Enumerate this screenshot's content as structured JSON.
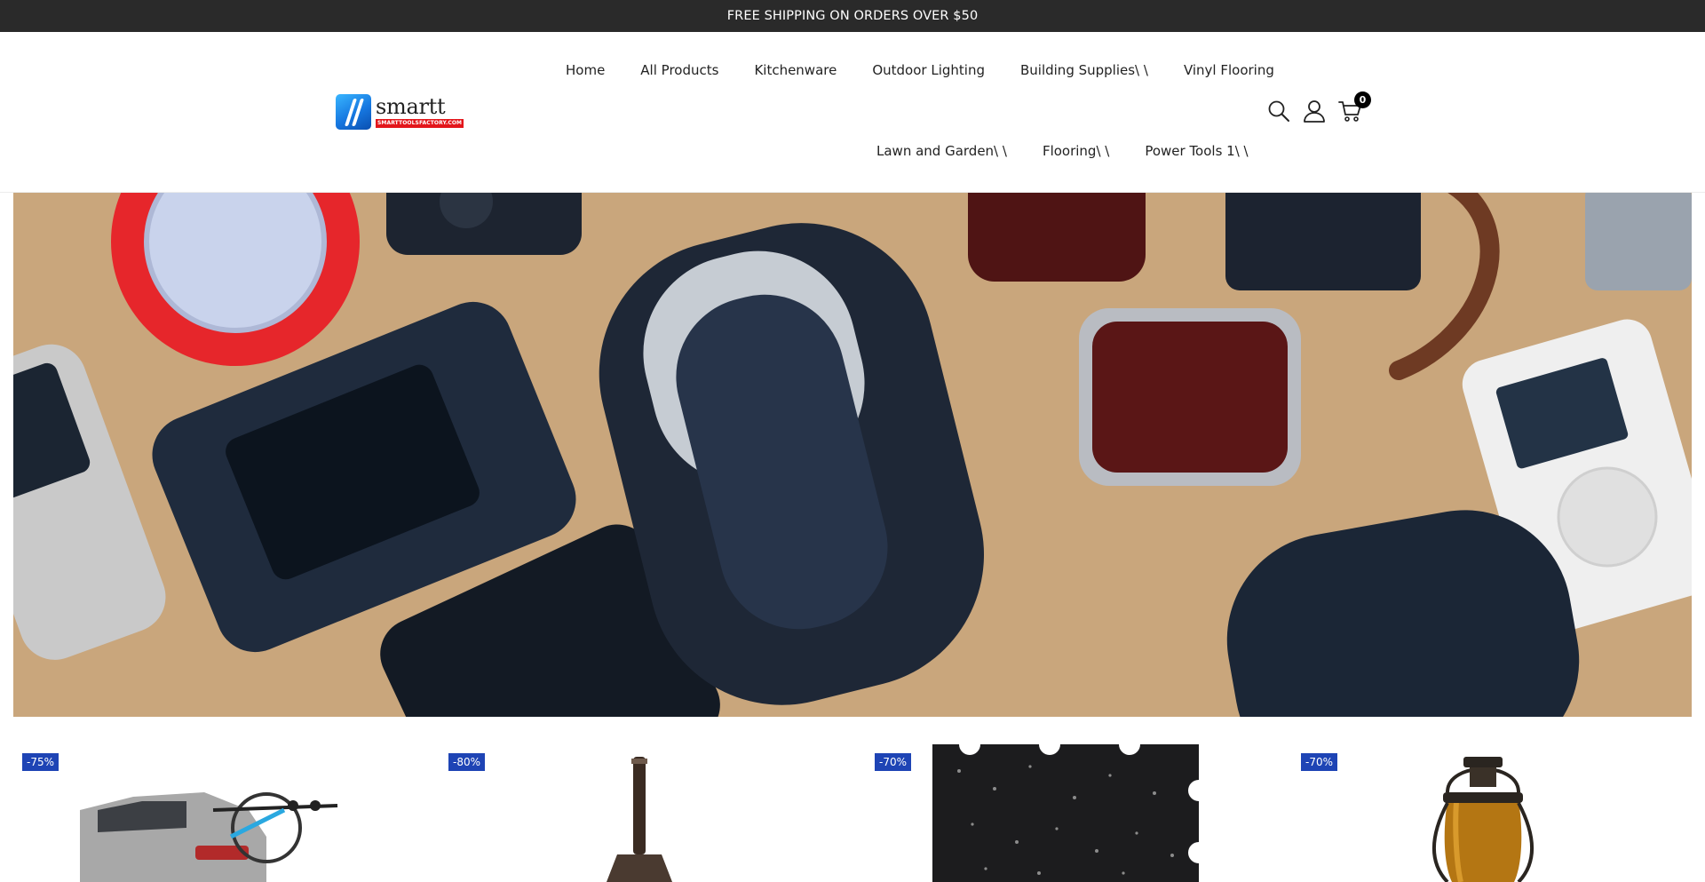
{
  "announcement": {
    "text": "FREE SHIPPING ON ORDERS OVER $50"
  },
  "logo": {
    "name": "smartt",
    "tagline": "SMARTTOOLSFACTORY.COM"
  },
  "nav": {
    "row1": [
      "Home",
      "All Products",
      "Kitchenware",
      "Outdoor Lighting",
      "Building Supplies\\ \\",
      "Vinyl Flooring"
    ],
    "row2": [
      "Lawn and Garden\\ \\",
      "Flooring\\ \\",
      "Power Tools 1\\ \\"
    ]
  },
  "header_icons": {
    "search": "search-icon",
    "account": "user-icon",
    "cart": "cart-icon",
    "cart_count": "0"
  },
  "hero": {
    "image": "flat-lay of electronics gadgets on kraft paper"
  },
  "products": [
    {
      "badge": "-75%",
      "image": "hatchback car with bike rack"
    },
    {
      "badge": "-80%",
      "image": "bicycle suspension fork"
    },
    {
      "badge": "-70%",
      "image": "black rubber interlocking floor tile"
    },
    {
      "badge": "-70%",
      "image": "amber glass hanging lantern"
    }
  ],
  "colors": {
    "announce_bg": "#2a2a2a",
    "badge_bg": "#1e44b5",
    "logo_red": "#e3161b",
    "logo_blue": "#1677e0"
  }
}
